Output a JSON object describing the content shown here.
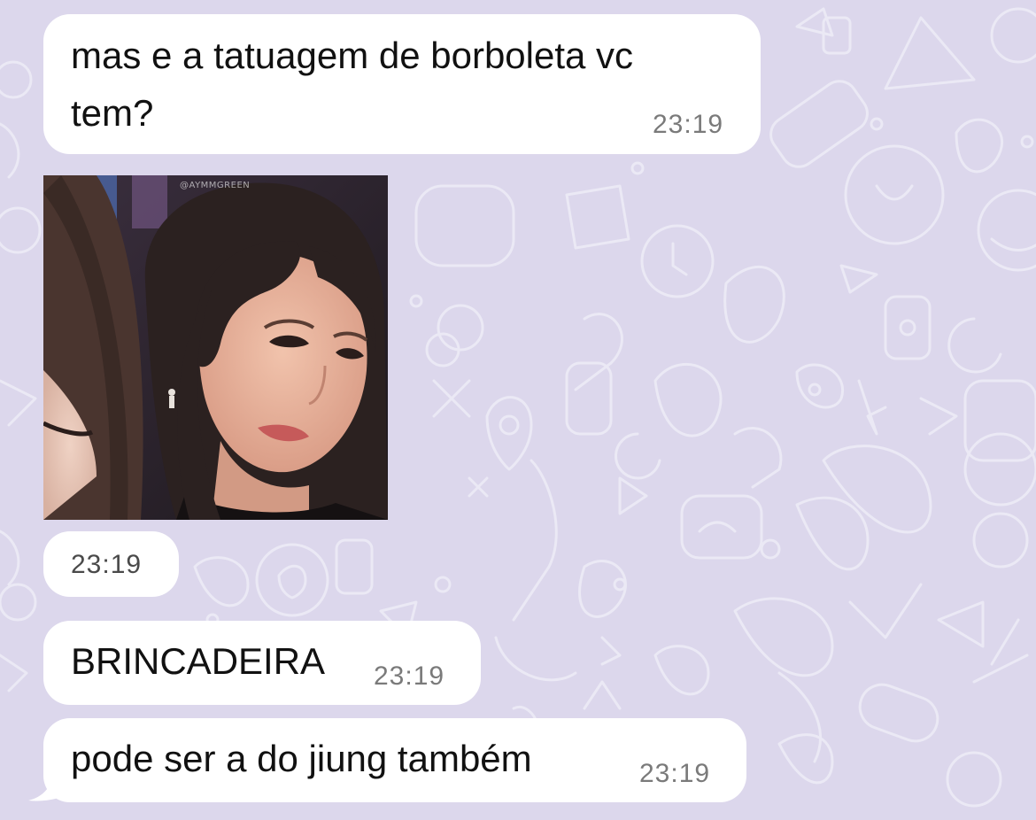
{
  "messages": [
    {
      "type": "text",
      "text_line1": "mas e a tatuagem de borboleta vc",
      "text_line2": "tem?",
      "time": "23:19"
    },
    {
      "type": "image",
      "watermark": "@AYMMGREEN",
      "time": "23:19"
    },
    {
      "type": "text",
      "text": "BRINCADEIRA",
      "time": "23:19"
    },
    {
      "type": "text",
      "text": "pode ser a do jiung também",
      "time": "23:19"
    }
  ],
  "colors": {
    "wallpaper": "#dcd7ec",
    "bubble": "#ffffff",
    "time": "#7a7a7a"
  },
  "icons": [
    "wallpaper-doodle-pattern",
    "photo-image"
  ]
}
